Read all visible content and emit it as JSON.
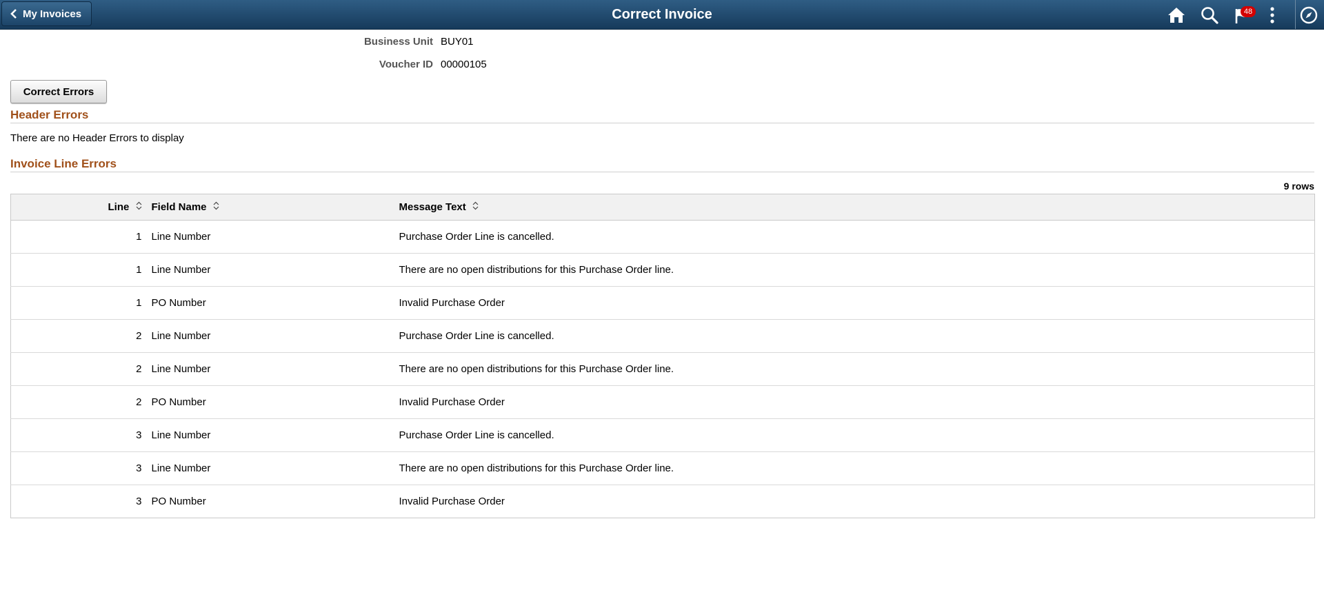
{
  "header": {
    "back_label": "My Invoices",
    "title": "Correct Invoice",
    "notification_count": "48",
    "icons": [
      "chevron-left-icon",
      "home-icon",
      "search-icon",
      "flag-icon",
      "more-vertical-icon",
      "compass-icon"
    ]
  },
  "summary": {
    "business_unit_label": "Business Unit",
    "business_unit_value": "BUY01",
    "voucher_id_label": "Voucher ID",
    "voucher_id_value": "00000105"
  },
  "actions": {
    "correct_errors_label": "Correct Errors"
  },
  "header_errors": {
    "title": "Header Errors",
    "empty_message": "There are no Header Errors to display"
  },
  "line_errors": {
    "title": "Invoice Line Errors",
    "rows_count": "9 rows",
    "columns": [
      "Line",
      "Field Name",
      "Message Text"
    ],
    "rows": [
      {
        "line": "1",
        "field": "Line Number",
        "message": "Purchase Order Line is cancelled."
      },
      {
        "line": "1",
        "field": "Line Number",
        "message": "There are no open distributions for this Purchase Order line."
      },
      {
        "line": "1",
        "field": "PO Number",
        "message": "Invalid Purchase Order"
      },
      {
        "line": "2",
        "field": "Line Number",
        "message": "Purchase Order Line is cancelled."
      },
      {
        "line": "2",
        "field": "Line Number",
        "message": "There are no open distributions for this Purchase Order line."
      },
      {
        "line": "2",
        "field": "PO Number",
        "message": "Invalid Purchase Order"
      },
      {
        "line": "3",
        "field": "Line Number",
        "message": "Purchase Order Line is cancelled."
      },
      {
        "line": "3",
        "field": "Line Number",
        "message": "There are no open distributions for this Purchase Order line."
      },
      {
        "line": "3",
        "field": "PO Number",
        "message": "Invalid Purchase Order"
      }
    ]
  },
  "colors": {
    "header_bar": "#1f4a70",
    "section_title": "#a0501a",
    "badge": "#d40000"
  }
}
